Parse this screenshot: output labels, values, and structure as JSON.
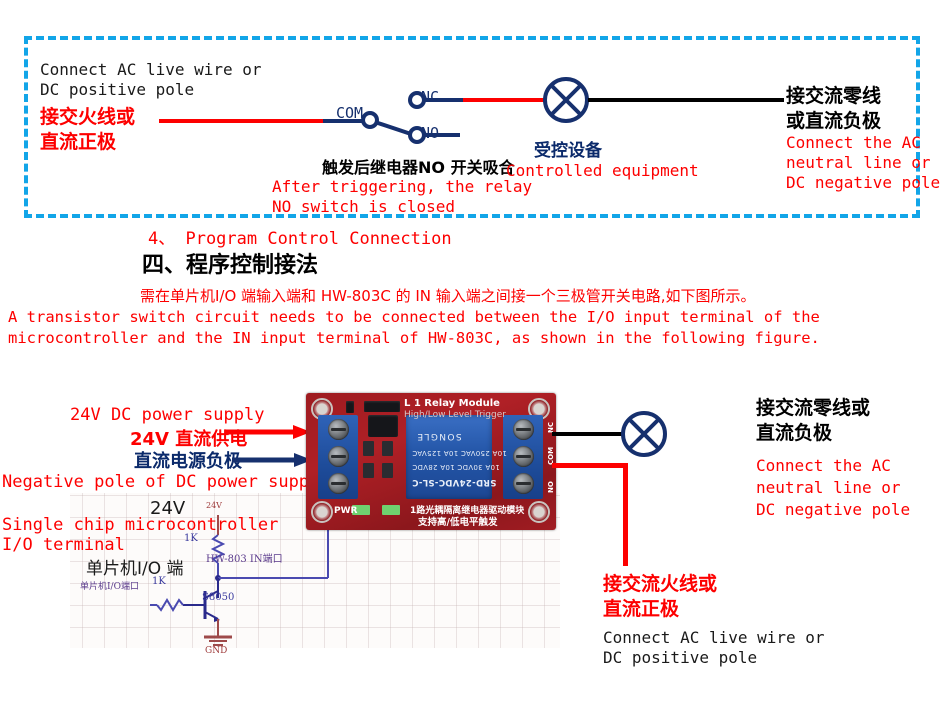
{
  "top_panel": {
    "left_label_en": "Connect AC live wire or\nDC positive pole",
    "left_label_cn": "接交火线或\n直流正极",
    "contact_com": "COM",
    "contact_nc": "NC",
    "contact_no": "NO",
    "relay_note_cn": "触发后继电器NO 开关吸合",
    "relay_note_en": "After triggering, the relay\nNO switch is closed",
    "device_label_cn": "受控设备",
    "device_label_en": "Controlled equipment",
    "right_label_cn": "接交流零线\n或直流负极",
    "right_label_en": "Connect the AC\nneutral line or\nDC negative pole",
    "border_color": "#12a5e8"
  },
  "section": {
    "heading_en": "4、 Program Control Connection",
    "heading_cn": "四、程序控制接法",
    "paragraph_cn": "需在单片机I/O 端输入端和 HW-803C 的 IN 输入端之间接一个三极管开关电路,如下图所示。",
    "paragraph_en": "A transistor switch circuit needs to be connected between the I/O input terminal of the\nmicrocontroller and the IN input terminal of HW-803C, as shown in the following figure."
  },
  "figure": {
    "supply_en": "24V DC power supply",
    "supply_cn": "24V 直流供电",
    "negative_cn": "直流电源负极",
    "negative_en": "Negative pole of DC power supply",
    "mcu_en": "Single chip microcontroller\nI/O terminal",
    "mcu_cn": "单片机I/O 端",
    "right_top_cn": "接交流零线或\n直流负极",
    "right_top_en": "Connect the AC\nneutral line or\nDC negative pole",
    "right_bottom_cn": "接交流火线或\n直流正极",
    "right_bottom_en": "Connect AC live wire or\nDC positive pole"
  },
  "schematic": {
    "v_label": "24V",
    "v_small": "24V",
    "r1": "1K",
    "r2": "1K",
    "transistor": "S8050",
    "gnd": "GND",
    "node_hw": "HW-803 IN端口",
    "node_mcu": "单片机I/O端口"
  },
  "board": {
    "title": "L 1 Relay Module",
    "subtitle": "High/Low Level Trigger",
    "relay_model": "SRD-24VDC-SL-C",
    "relay_rating_1": "10A 250VAC   10A 125VAC",
    "relay_rating_2": "10A 30VDC    10A 28VDC",
    "relay_brand": "SONGLE",
    "pwr_label": "PWR",
    "bottom_cn_1": "1路光耦隔离继电器驱动模块",
    "bottom_cn_2": "支持高/低电平触发",
    "pin_nc": "NC",
    "pin_com": "COM",
    "pin_no": "NO"
  },
  "colors": {
    "red": "#fd0000",
    "navy": "#16306e",
    "cyan": "#12a5e8",
    "black": "#000000"
  }
}
